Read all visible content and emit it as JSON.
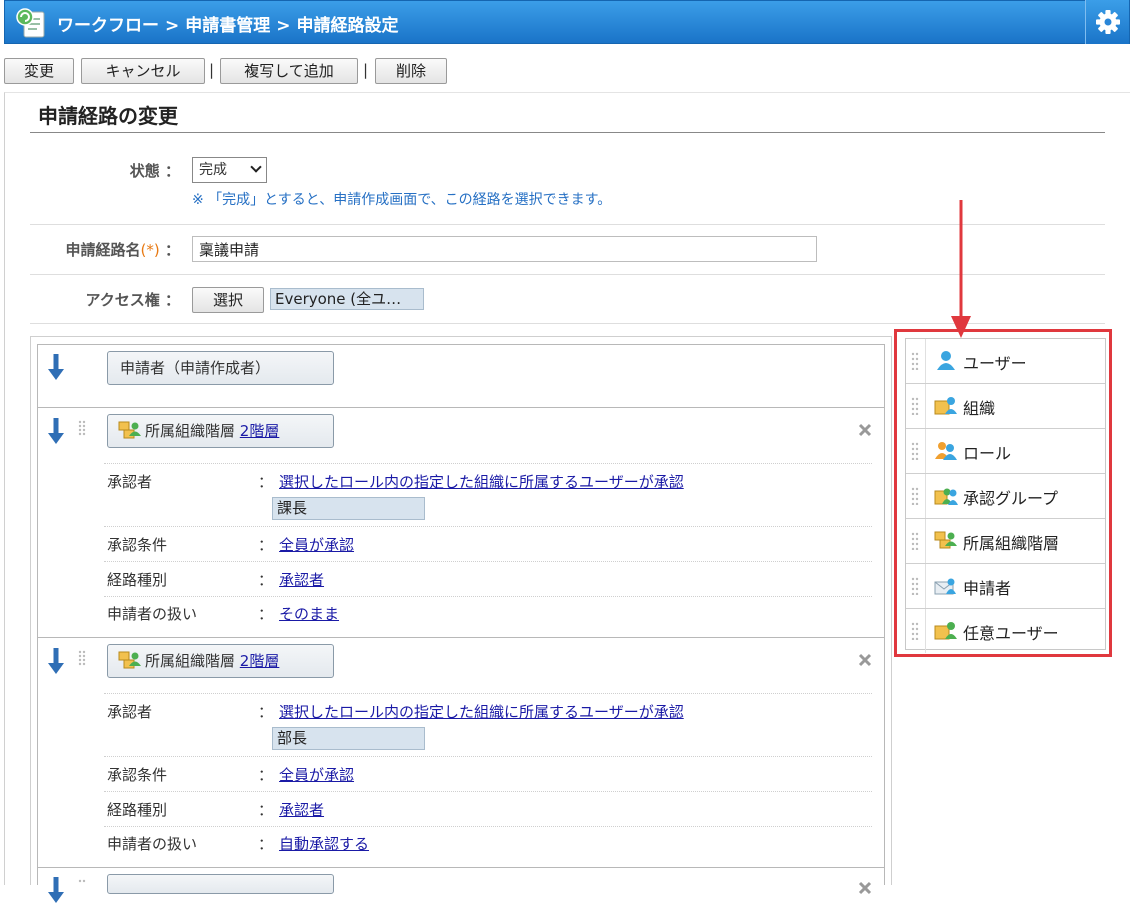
{
  "header": {
    "breadcrumb": [
      "ワークフロー",
      "申請書管理",
      "申請経路設定"
    ],
    "separator": ">"
  },
  "toolbar": {
    "change_label": "変更",
    "cancel_label": "キャンセル",
    "copy_add_label": "複写して追加",
    "delete_label": "削除",
    "divider": "|"
  },
  "page": {
    "title": "申請経路の変更"
  },
  "form": {
    "status": {
      "label": "状態",
      "colon": "：",
      "selected": "完成",
      "note": "※ 「完成」とすると、申請作成画面で、この経路を選択できます。"
    },
    "route_name": {
      "label": "申請経路名",
      "required_mark": "(*)",
      "colon": "：",
      "value": "稟議申請"
    },
    "access": {
      "label": "アクセス権",
      "colon": "：",
      "select_label": "選択",
      "value": "Everyone (全ユ…"
    }
  },
  "route": {
    "applicant_label": "申請者（申請作成者）",
    "steps": [
      {
        "type_label": "所属組織階層",
        "level_link": "2階層",
        "details": [
          {
            "label": "承認者",
            "value": "選択したロール内の指定した組織に所属するユーザーが承認"
          },
          {
            "label": "承認条件",
            "value": "全員が承認"
          },
          {
            "label": "経路種別",
            "value": "承認者"
          },
          {
            "label": "申請者の扱い",
            "value": "そのまま"
          }
        ],
        "role": "課長"
      },
      {
        "type_label": "所属組織階層",
        "level_link": "2階層",
        "details": [
          {
            "label": "承認者",
            "value": "選択したロール内の指定した組織に所属するユーザーが承認"
          },
          {
            "label": "承認条件",
            "value": "全員が承認"
          },
          {
            "label": "経路種別",
            "value": "承認者"
          },
          {
            "label": "申請者の扱い",
            "value": "自動承認する"
          }
        ],
        "role": "部長"
      }
    ],
    "colon": "："
  },
  "palette": {
    "items": [
      {
        "label": "ユーザー",
        "icon": "user-icon"
      },
      {
        "label": "組織",
        "icon": "organization-icon"
      },
      {
        "label": "ロール",
        "icon": "role-icon"
      },
      {
        "label": "承認グループ",
        "icon": "approval-group-icon"
      },
      {
        "label": "所属組織階層",
        "icon": "org-hierarchy-icon"
      },
      {
        "label": "申請者",
        "icon": "applicant-icon"
      },
      {
        "label": "任意ユーザー",
        "icon": "any-user-icon"
      }
    ]
  },
  "colors": {
    "header_blue": "#1a74c8",
    "highlight_red": "#e0383e",
    "link_blue": "#1a1aa6",
    "note_blue": "#2670c4",
    "required_orange": "#e87a14"
  }
}
